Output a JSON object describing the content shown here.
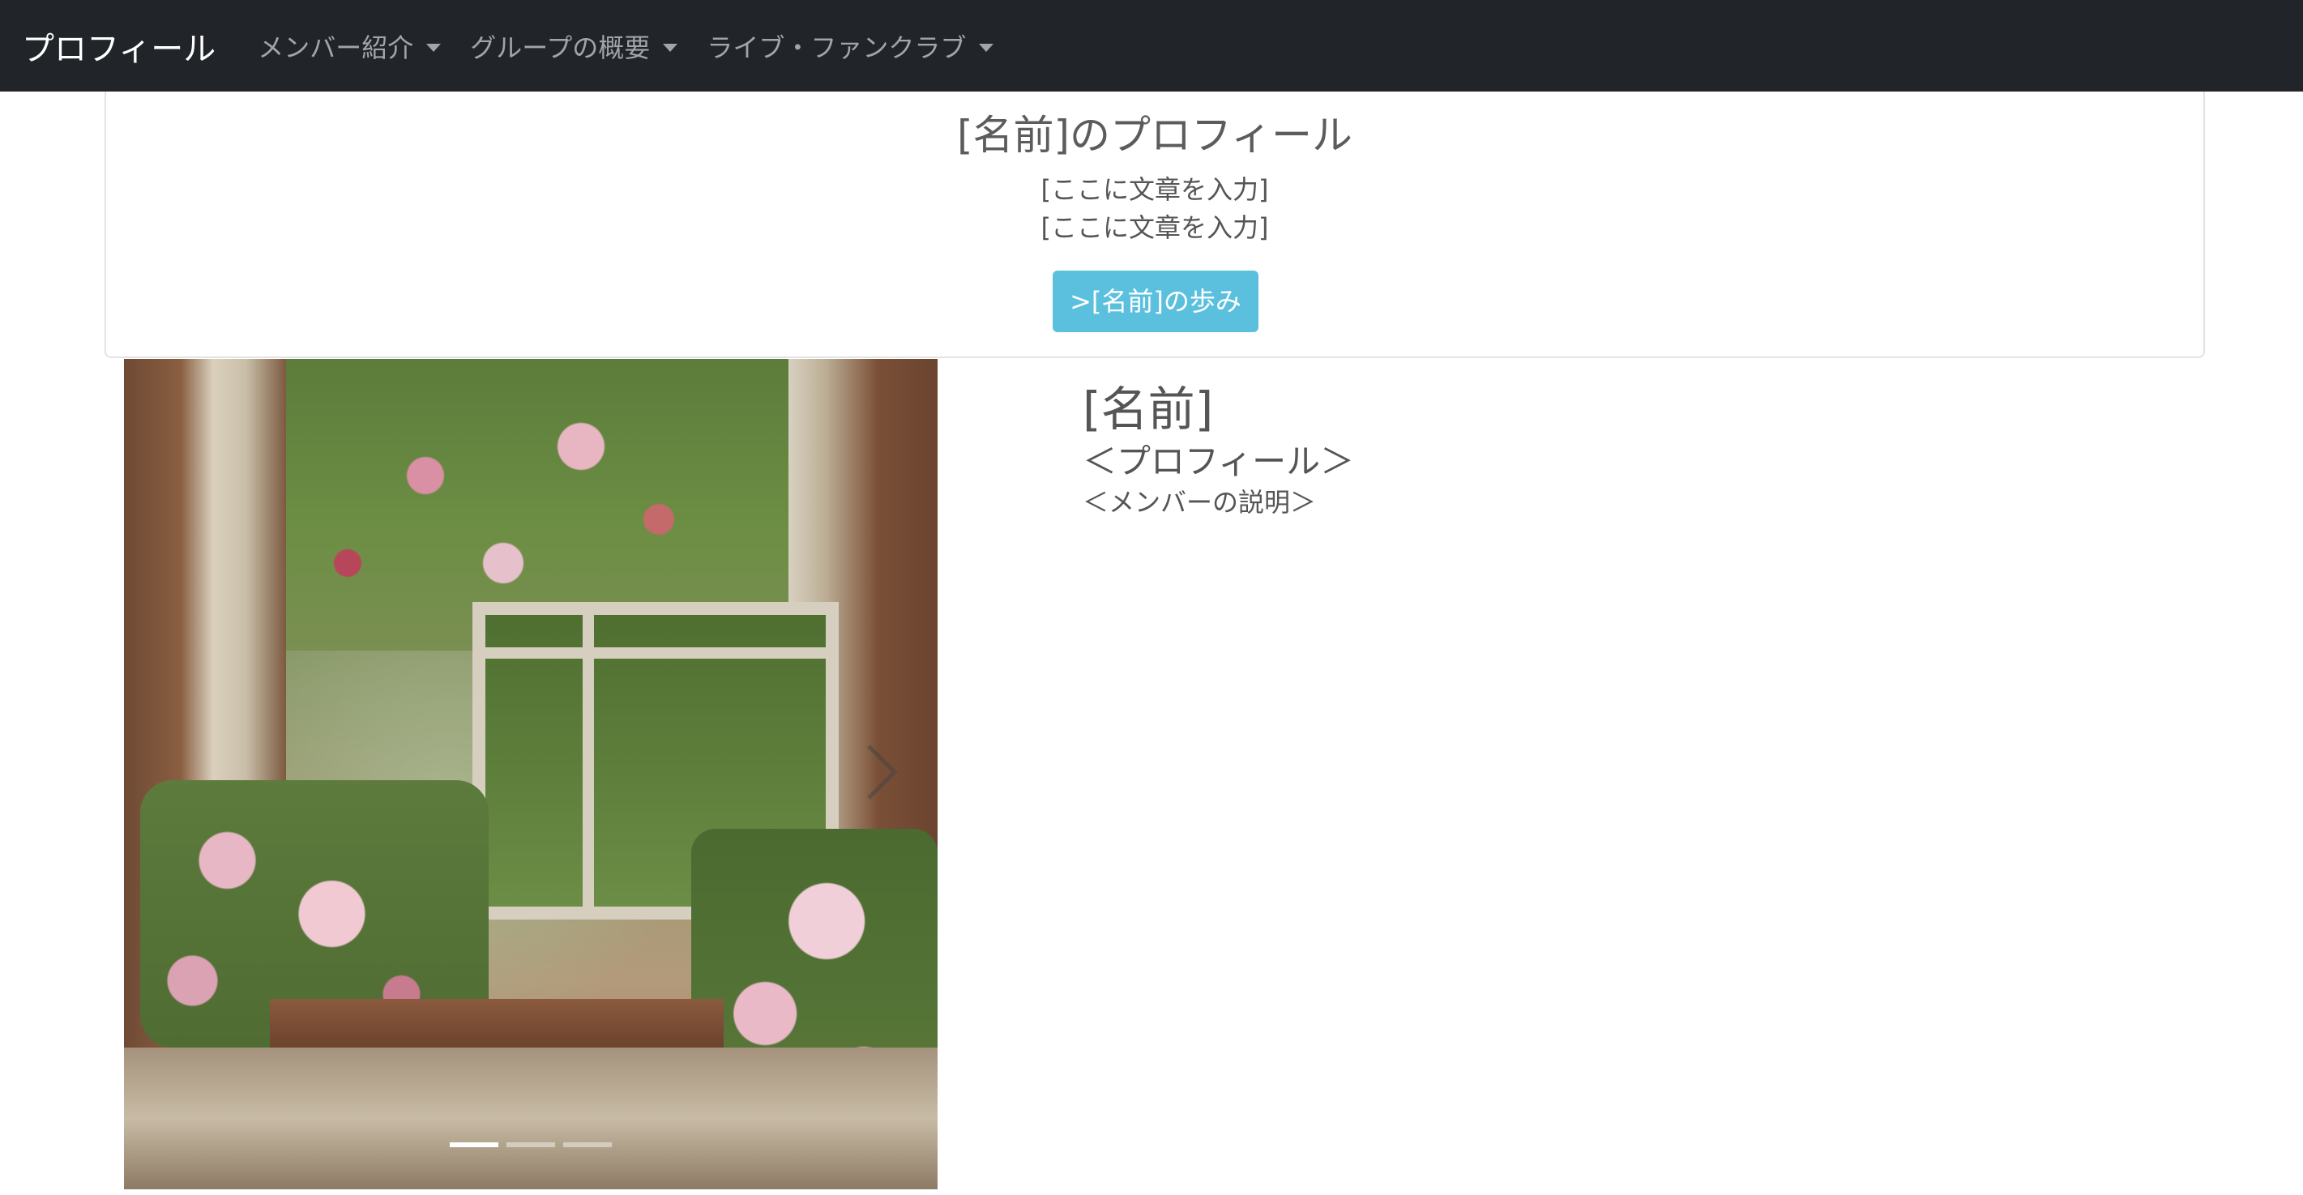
{
  "navbar": {
    "brand": "プロフィール",
    "items": [
      {
        "label": "メンバー紹介"
      },
      {
        "label": "グループの概要"
      },
      {
        "label": "ライブ・ファンクラブ"
      }
    ]
  },
  "header_card": {
    "title": "[名前]のプロフィール",
    "lines": [
      "[ここに文章を入力]",
      "[ここに文章を入力]"
    ],
    "button_label": ">[名前]の歩み",
    "button_color": "#5bc0de"
  },
  "carousel": {
    "indicator_count": 3,
    "active_index": 0,
    "next_icon": "chevron-right-icon"
  },
  "member": {
    "name": "[名前]",
    "profile_heading": "＜プロフィール＞",
    "description": "＜メンバーの説明＞"
  },
  "colors": {
    "navbar_bg": "#212529",
    "nav_text": "#a1a5a9",
    "brand_text": "#ffffff"
  }
}
